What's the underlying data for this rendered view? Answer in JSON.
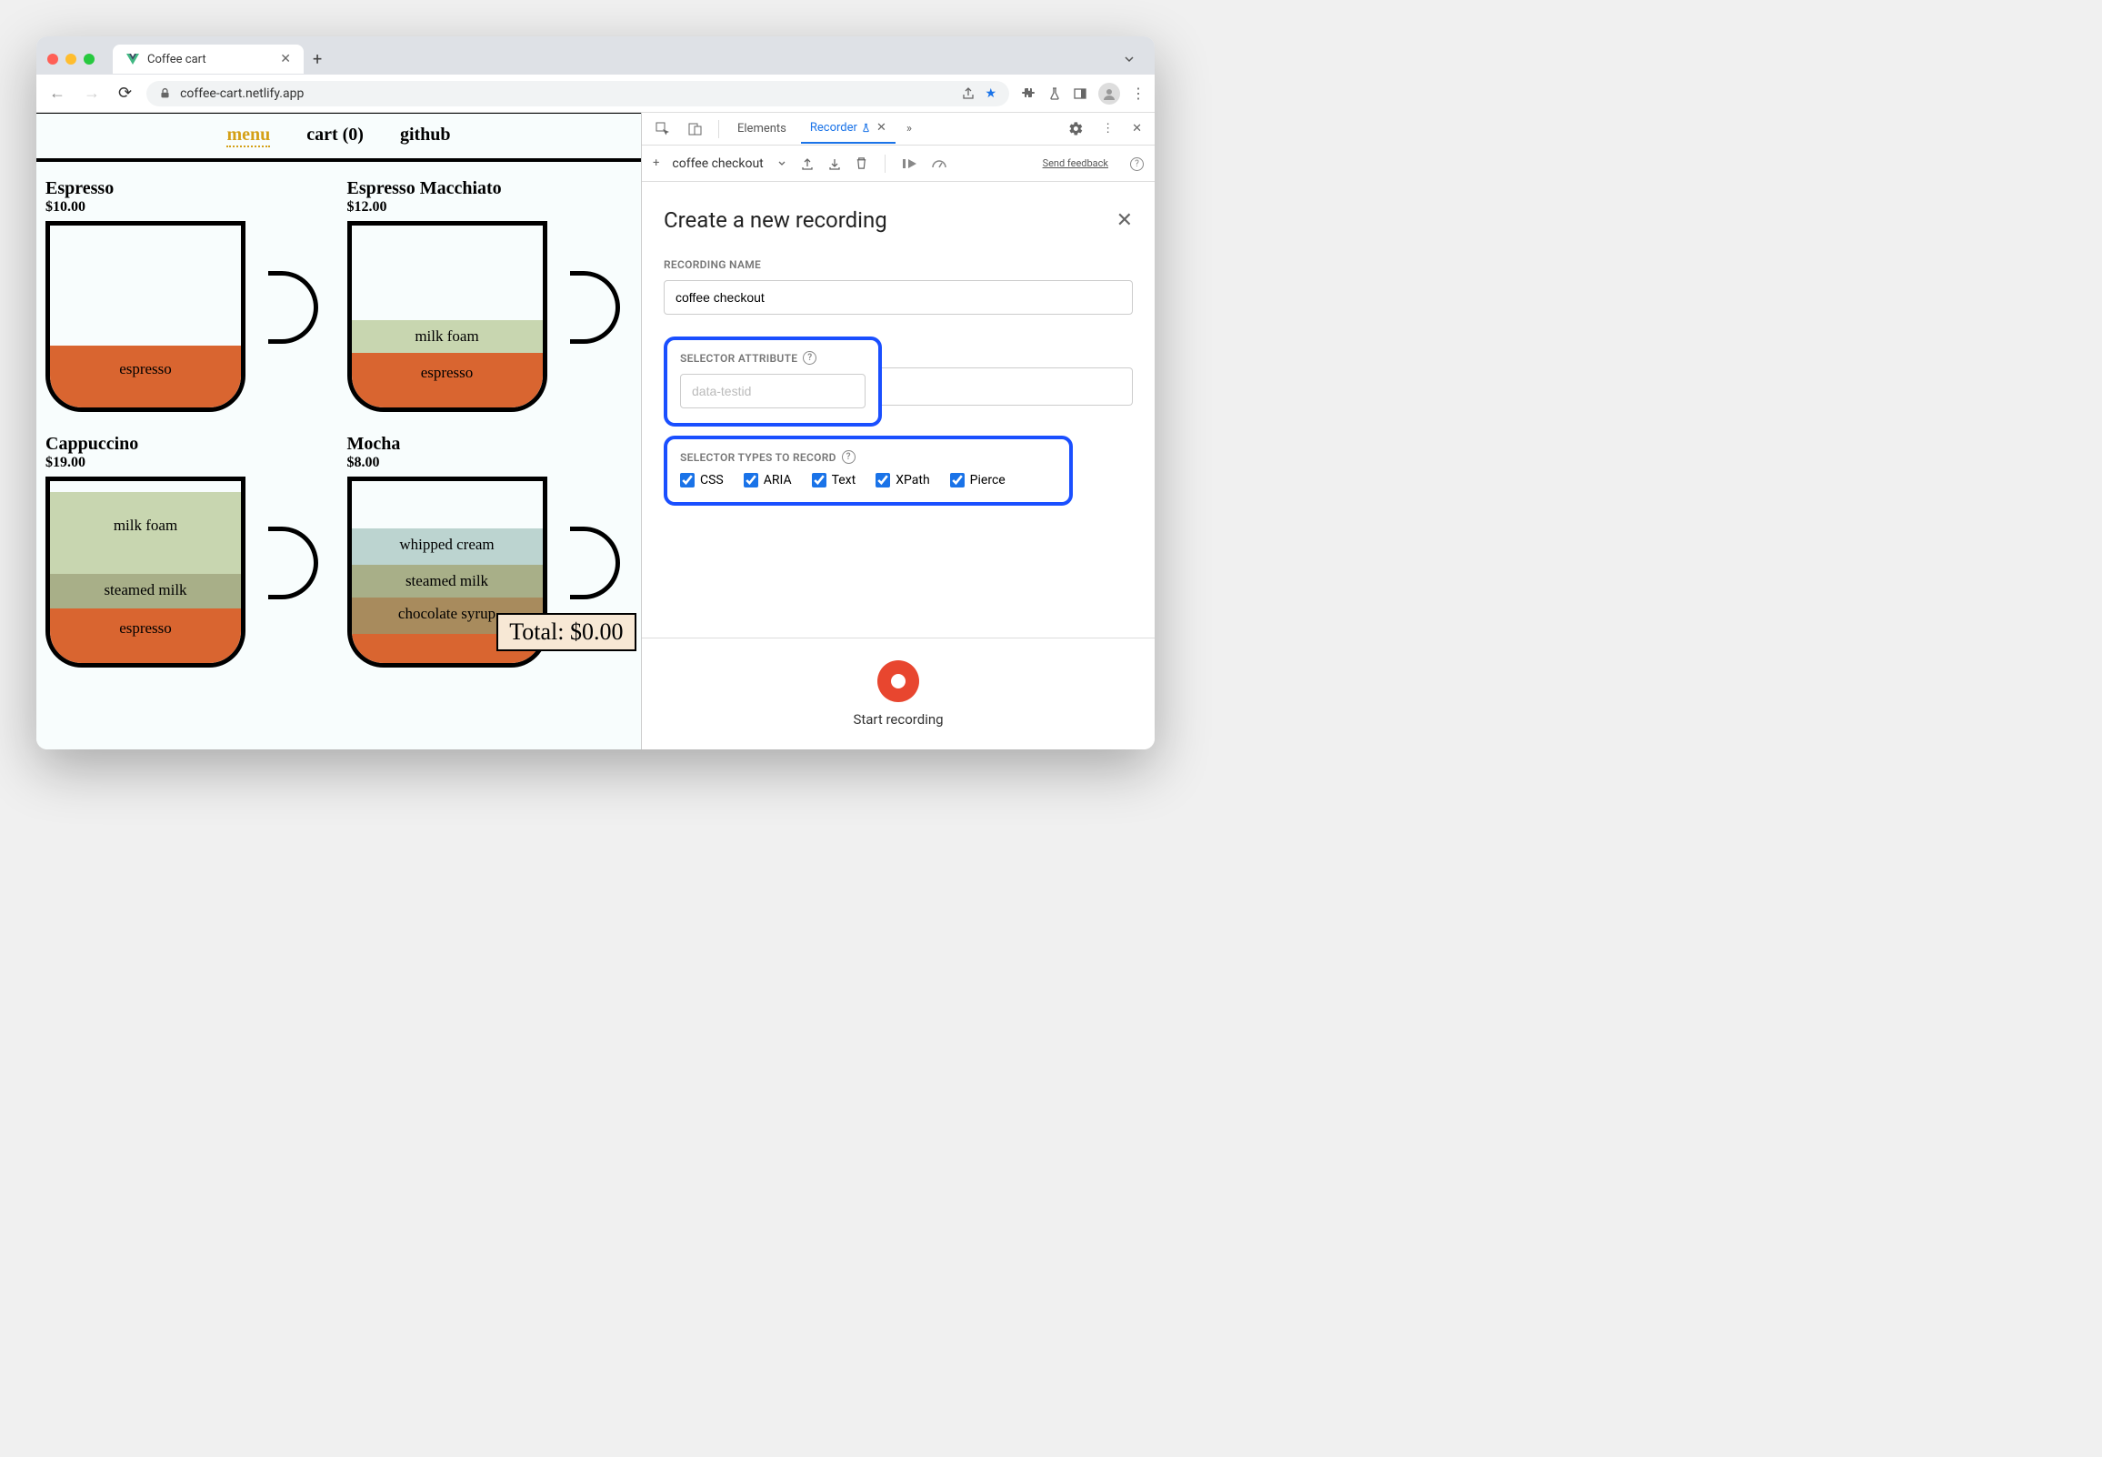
{
  "browser": {
    "tab_title": "Coffee cart",
    "url": "coffee-cart.netlify.app"
  },
  "page": {
    "nav": {
      "menu": "menu",
      "cart": "cart (0)",
      "github": "github"
    },
    "products": [
      {
        "name": "Espresso",
        "price": "$10.00"
      },
      {
        "name": "Espresso Macchiato",
        "price": "$12.00"
      },
      {
        "name": "Cappuccino",
        "price": "$19.00"
      },
      {
        "name": "Mocha",
        "price": "$8.00"
      }
    ],
    "layers": {
      "espresso": "espresso",
      "milk_foam": "milk foam",
      "steamed_milk": "steamed milk",
      "whipped_cream": "whipped cream",
      "chocolate_syrup": "chocolate syrup"
    },
    "total_label": "Total: $0.00"
  },
  "devtools": {
    "tabs": {
      "elements": "Elements",
      "recorder": "Recorder"
    },
    "recording_name_toolbar": "coffee checkout",
    "feedback": "Send feedback",
    "panel": {
      "title": "Create a new recording",
      "name_label": "RECORDING NAME",
      "name_value": "coffee checkout",
      "selector_attr_label": "SELECTOR ATTRIBUTE",
      "selector_attr_placeholder": "data-testid",
      "selector_types_label": "SELECTOR TYPES TO RECORD",
      "types": {
        "css": "CSS",
        "aria": "ARIA",
        "text": "Text",
        "xpath": "XPath",
        "pierce": "Pierce"
      },
      "start_label": "Start recording"
    }
  }
}
